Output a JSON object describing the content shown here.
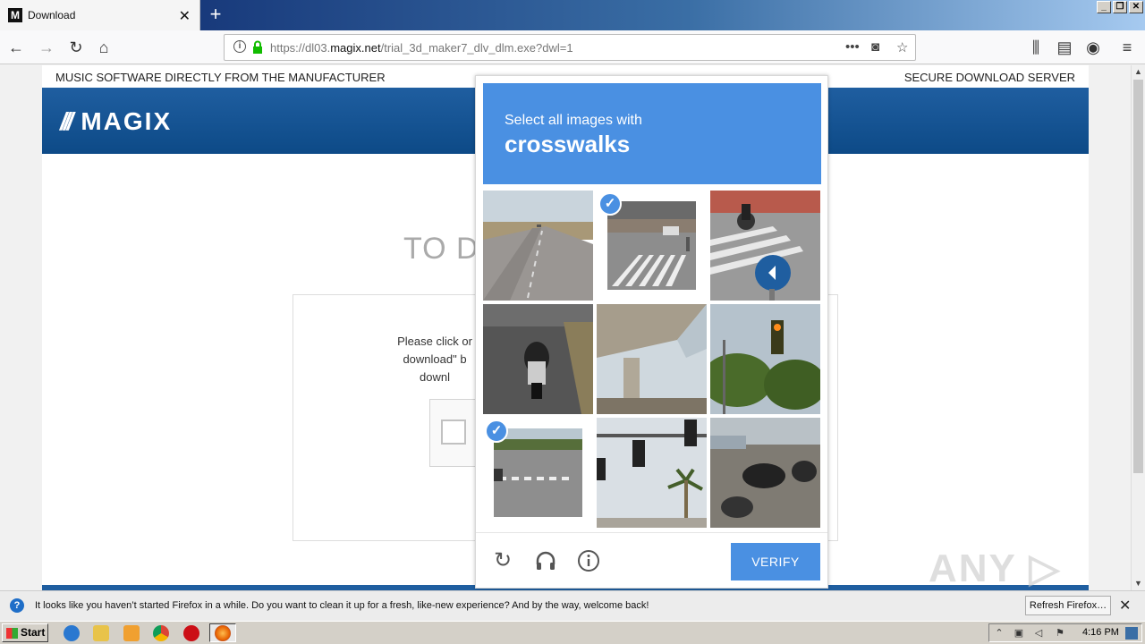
{
  "browser": {
    "tab": {
      "favicon_letter": "M",
      "title": "Download",
      "close": "✕"
    },
    "new_tab": "+",
    "url_prefix": "https://dl03.",
    "url_domain": "magix.net",
    "url_path": "/trial_3d_maker7_dlv_dlm.exe?dwl=1",
    "url_more": "•••"
  },
  "page": {
    "top_left": "MUSIC SOFTWARE DIRECTLY FROM THE MANUFACTURER",
    "top_right": "SECURE DOWNLOAD SERVER",
    "logo_mark": "///",
    "logo_text": "MAGIX",
    "heading_fragment": "TO DO",
    "instructions_line1": "Please click or",
    "instructions_line2": "download\" b",
    "instructions_line3": "downl"
  },
  "challenge": {
    "prompt": "Select all images with",
    "target": "crosswalks",
    "selected_tiles": [
      1,
      6
    ],
    "verify_label": "VERIFY",
    "icons": [
      "refresh-icon",
      "headphones-icon",
      "info-icon"
    ]
  },
  "watermark": "ANY ▷ RUN",
  "notification": {
    "text": "It looks like you haven’t started Firefox in a while. Do you want to clean it up for a fresh, like-new experience? And by the way, welcome back!",
    "button": "Refresh Firefox…",
    "close": "✕"
  },
  "taskbar": {
    "start_label": "Start",
    "clock": "4:16 PM"
  }
}
